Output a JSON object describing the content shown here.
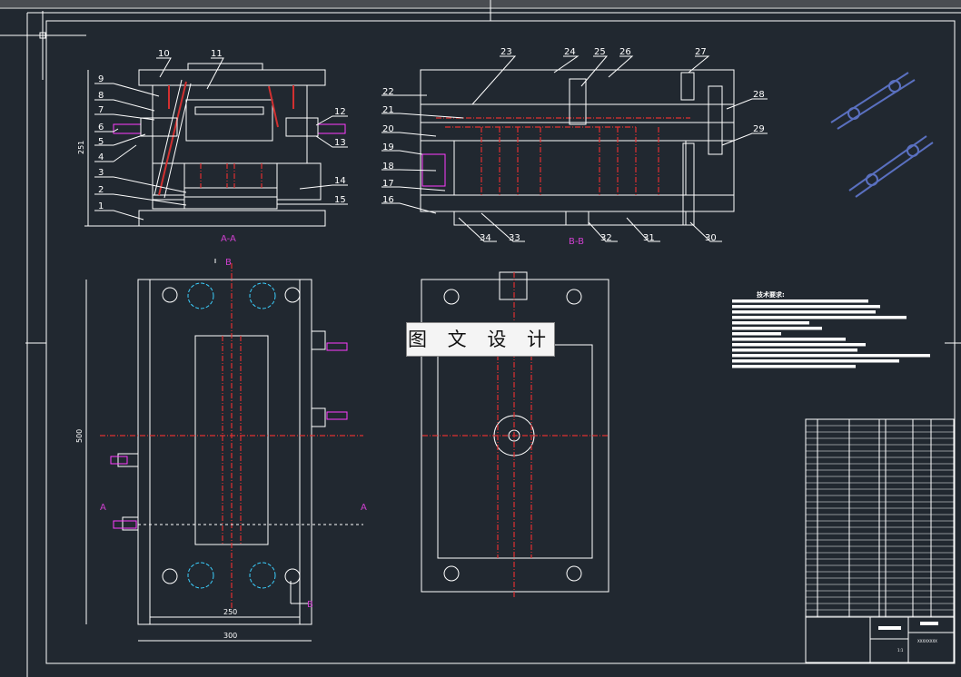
{
  "drawing": {
    "section_aa_label": "A-A",
    "section_bb_label": "B-B",
    "cut_marker_a": "A",
    "cut_marker_b": "B",
    "dimensions": {
      "height_section": "251",
      "plan_height": "500",
      "plan_inner_width": "250",
      "plan_outer_width": "300"
    },
    "parts_left": [
      "1",
      "2",
      "3",
      "4",
      "5",
      "6",
      "7",
      "8",
      "9",
      "10",
      "11",
      "12",
      "13",
      "14",
      "15"
    ],
    "parts_right": [
      "16",
      "17",
      "18",
      "19",
      "20",
      "21",
      "22",
      "23",
      "24",
      "25",
      "26",
      "27",
      "28",
      "29",
      "30",
      "31",
      "32",
      "33",
      "34"
    ]
  },
  "watermark": "图 文 设 计",
  "technical_requirements": {
    "title": "技术要求:",
    "line_count": 13
  },
  "title_block": {
    "code": "XXXXXXXX",
    "scale": "1:1"
  },
  "colors": {
    "background": "#212830",
    "lines": "#ffffff",
    "centerlines": "#e03030",
    "section_marks": "#d040d0"
  }
}
